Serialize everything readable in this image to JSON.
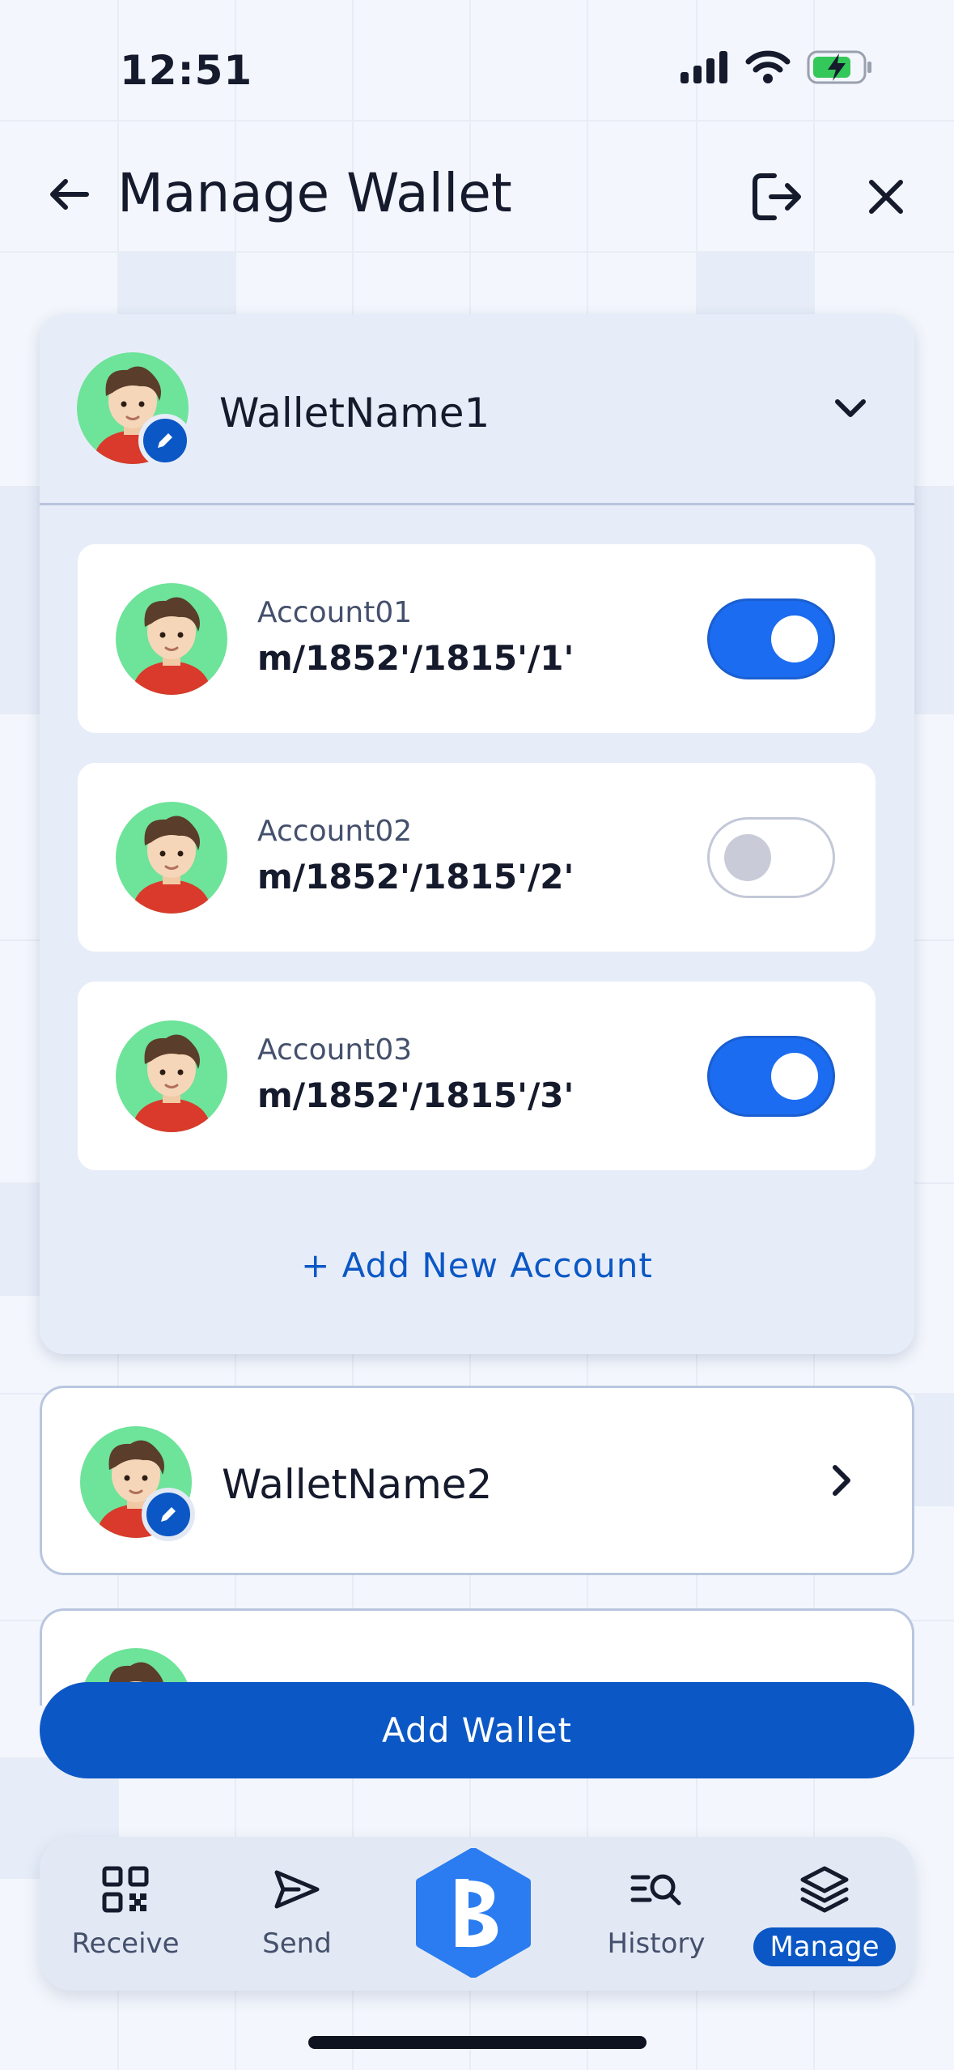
{
  "status_bar": {
    "time": "12:51"
  },
  "header": {
    "title": "Manage Wallet"
  },
  "wallets": [
    {
      "name": "WalletName1",
      "expanded": true,
      "accounts": [
        {
          "label": "Account01",
          "path": "m/1852'/1815'/1'",
          "enabled": true
        },
        {
          "label": "Account02",
          "path": "m/1852'/1815'/2'",
          "enabled": false
        },
        {
          "label": "Account03",
          "path": "m/1852'/1815'/3'",
          "enabled": true
        }
      ],
      "add_account_label": "+ Add New Account"
    },
    {
      "name": "WalletName2",
      "expanded": false
    }
  ],
  "add_wallet_label": "Add Wallet",
  "bottom_nav": {
    "items": [
      {
        "label": "Receive",
        "icon": "qr-code-icon"
      },
      {
        "label": "Send",
        "icon": "send-icon"
      },
      {
        "label": "History",
        "icon": "history-search-icon"
      },
      {
        "label": "Manage",
        "icon": "layers-icon",
        "active": true
      }
    ]
  },
  "colors": {
    "primary": "#0b57c5",
    "toggle_on": "#1b6cf0",
    "card_bg": "#e7edf8"
  }
}
